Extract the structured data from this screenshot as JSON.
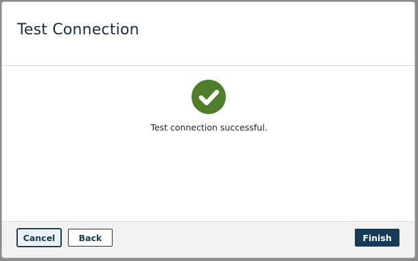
{
  "dialog": {
    "title": "Test Connection"
  },
  "status": {
    "icon": "check-circle-icon",
    "color": "#4f7d2b",
    "message": "Test connection successful."
  },
  "footer": {
    "cancel_label": "Cancel",
    "back_label": "Back",
    "finish_label": "Finish"
  },
  "colors": {
    "primary": "#173a56",
    "success": "#4f7d2b"
  }
}
